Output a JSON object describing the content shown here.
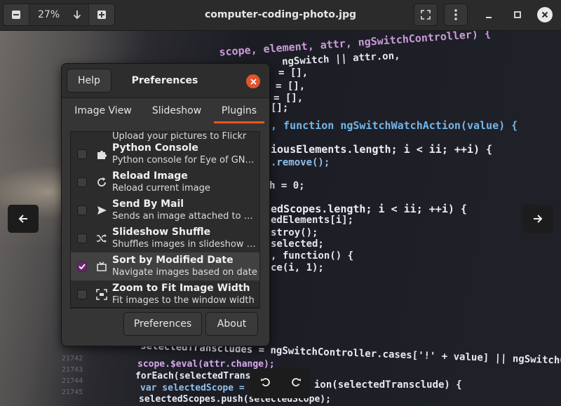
{
  "header": {
    "zoom_out_icon": "minus-icon",
    "zoom_value": "27%",
    "zoom_menu_icon": "arrow-down-icon",
    "zoom_in_icon": "plus-icon",
    "title": "computer-coding-photo.jpg",
    "fullscreen_icon": "fullscreen-icon",
    "menu_icon": "kebab-menu-icon",
    "minimize_icon": "minimize-icon",
    "maximize_icon": "maximize-icon",
    "close_icon": "close-icon"
  },
  "photo": {
    "code_lines": [
      "scope, element, attr, ngSwitchController) {",
      "ngSwitch || attr.on,",
      "= [],",
      "= [],",
      "= [],",
      "[];",
      ", function ngSwitchWatchAction(value) {",
      "iousElements.length; i < ii; ++i) {",
      ".remove();",
      "h = 0;",
      "edScopes.length; i < ii; ++i) {",
      "edElements[i];",
      "stroy();",
      "selected;",
      ", function() {",
      "ce(i, 1);",
      "selectedTranscludes = ngSwitchController.cases['!' + value] || ngSwitchC",
      "scope.$eval(attr.change);",
      "forEach(selectedTranscl",
      "var selectedScope = sc",
      "selectedScopes.push(selectedScope);",
      "ion(selectedTransclude) {"
    ],
    "line_numbers": [
      "21742",
      "21743",
      "21744",
      "21745"
    ],
    "prev_icon": "arrow-left-icon",
    "next_icon": "arrow-right-icon",
    "rotate_left_icon": "rotate-left-icon",
    "rotate_right_icon": "rotate-right-icon"
  },
  "dialog": {
    "help_label": "Help",
    "title": "Preferences",
    "close_icon": "close-icon",
    "tabs": [
      {
        "label": "Image View",
        "active": false
      },
      {
        "label": "Slideshow",
        "active": false
      },
      {
        "label": "Plugins",
        "active": true
      }
    ],
    "partial_row_desc": "Upload your pictures to Flickr",
    "plugins": [
      {
        "name": "Python Console",
        "desc": "Python console for Eye of GNOME",
        "checked": false,
        "icon": "puzzle-piece-icon"
      },
      {
        "name": "Reload Image",
        "desc": "Reload current image",
        "checked": false,
        "icon": "reload-icon"
      },
      {
        "name": "Send By Mail",
        "desc": "Sends an image attached to a new mail",
        "checked": false,
        "icon": "send-icon"
      },
      {
        "name": "Slideshow Shuffle",
        "desc": "Shuffles images in slideshow mode",
        "checked": false,
        "icon": "shuffle-icon"
      },
      {
        "name": "Sort by Modified Date",
        "desc": "Navigate images based on date",
        "checked": true,
        "icon": "sort-date-icon"
      },
      {
        "name": "Zoom to Fit Image Width",
        "desc": "Fit images to the window width",
        "checked": false,
        "icon": "zoom-fit-icon"
      }
    ],
    "footer": {
      "preferences_label": "Preferences",
      "about_label": "About"
    }
  }
}
